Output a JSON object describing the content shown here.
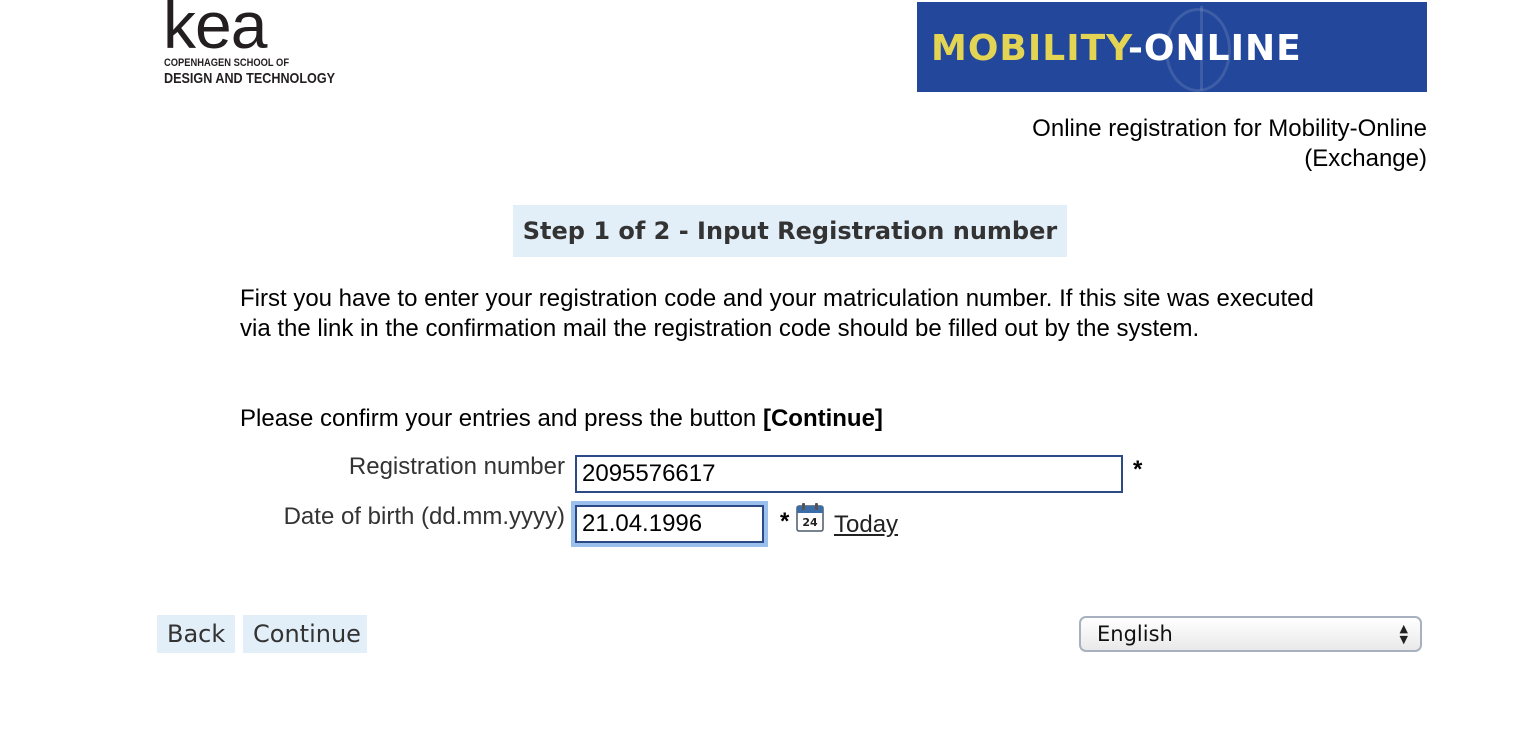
{
  "header": {
    "kea_logo": {
      "wordmark": "kea",
      "line1": "COPENHAGEN SCHOOL OF",
      "line2": "DESIGN AND TECHNOLOGY"
    },
    "mobility_banner": {
      "text_part1": "MOBILITY",
      "text_sep": "-",
      "text_part2": "ONLINE",
      "colors": {
        "background": "#23479a",
        "yellow": "#e3d553",
        "white": "#ffffff"
      }
    },
    "subtitle_line1": "Online registration for Mobility-Online",
    "subtitle_line2": "(Exchange)"
  },
  "step": {
    "title": "Step 1 of 2 - Input Registration number"
  },
  "intro_text": "First you have to enter your registration code and your matriculation number. If this site was executed via the link in the confirmation mail the registration code should be filled out by the system.",
  "confirm": {
    "text": "Please confirm your entries and press the button ",
    "button_ref": "[Continue]"
  },
  "form": {
    "registration": {
      "label": "Registration number",
      "value": "2095576617",
      "required_mark": "*"
    },
    "dob": {
      "label": "Date of birth (dd.mm.yyyy)",
      "value": "21.04.1996",
      "required_mark": "*",
      "calendar_icon": "calendar-icon",
      "calendar_day": "24",
      "today_link": "Today"
    }
  },
  "buttons": {
    "back": "Back",
    "continue": "Continue"
  },
  "language": {
    "selected": "English"
  },
  "theme": {
    "step_bg": "#e3eff8",
    "input_border": "#2b4a86",
    "focus_ring": "#9cc0ee"
  }
}
